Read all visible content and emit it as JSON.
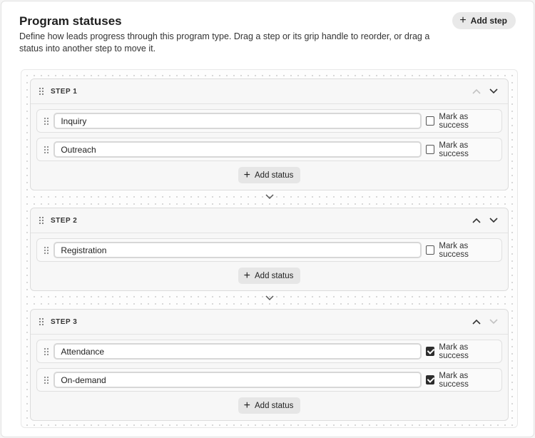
{
  "header": {
    "title": "Program statuses",
    "description": "Define how leads progress through this program type. Drag a step or its grip handle to reorder, or drag a status into another step to move it.",
    "add_step_label": "Add step"
  },
  "common": {
    "mark_success_label": "Mark as success",
    "add_status_label": "Add status"
  },
  "steps": [
    {
      "name": "STEP 1",
      "statuses": [
        {
          "value": "Inquiry",
          "success": false
        },
        {
          "value": "Outreach",
          "success": false
        }
      ]
    },
    {
      "name": "STEP 2",
      "statuses": [
        {
          "value": "Registration",
          "success": false
        }
      ]
    },
    {
      "name": "STEP 3",
      "statuses": [
        {
          "value": "Attendance",
          "success": true
        },
        {
          "value": "On-demand",
          "success": true
        }
      ]
    }
  ],
  "icons": {
    "grip": "grip-vertical-icon",
    "up": "chevron-up-icon",
    "down": "chevron-down-icon",
    "plus": "plus-icon"
  }
}
